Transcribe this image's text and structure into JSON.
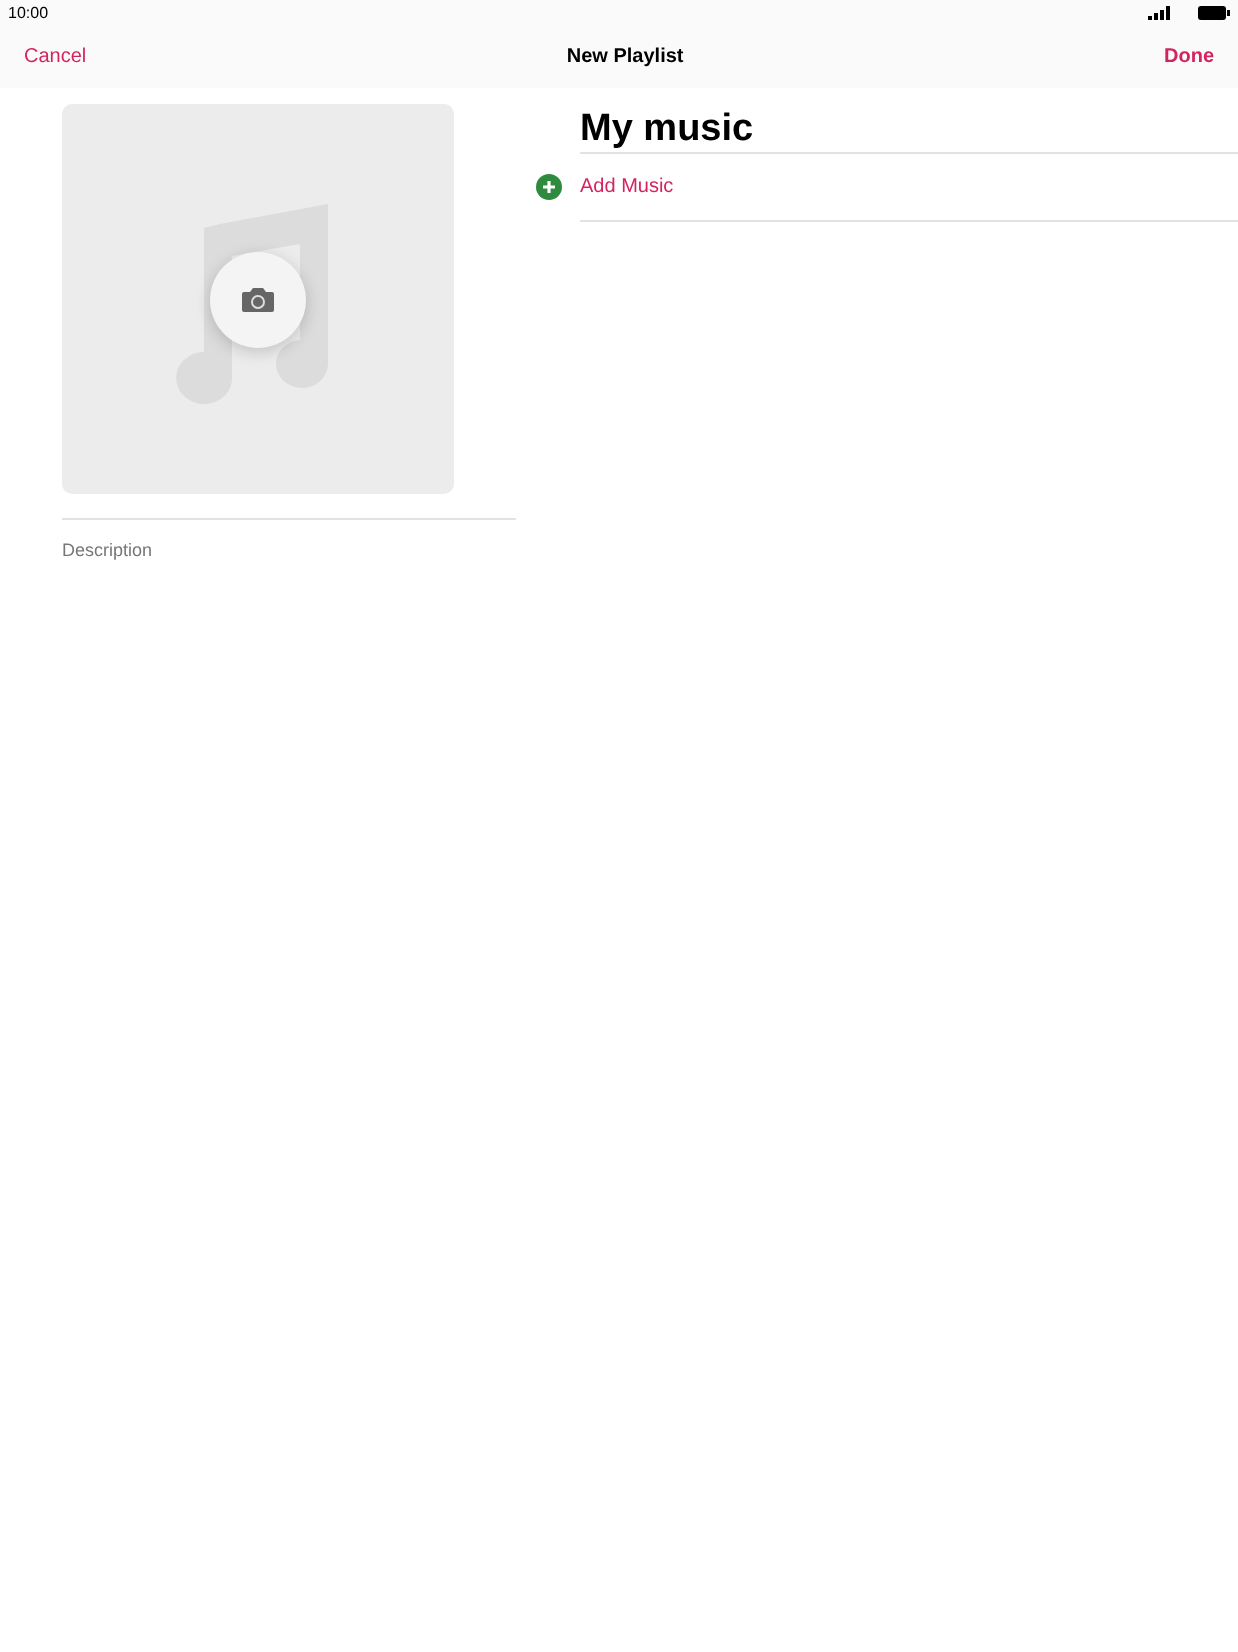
{
  "status_bar": {
    "time": "10:00"
  },
  "nav_bar": {
    "cancel": "Cancel",
    "title": "New Playlist",
    "done": "Done"
  },
  "playlist": {
    "name": "My music",
    "description": {
      "placeholder": "Description"
    }
  },
  "add_music": {
    "label": "Add Music"
  }
}
